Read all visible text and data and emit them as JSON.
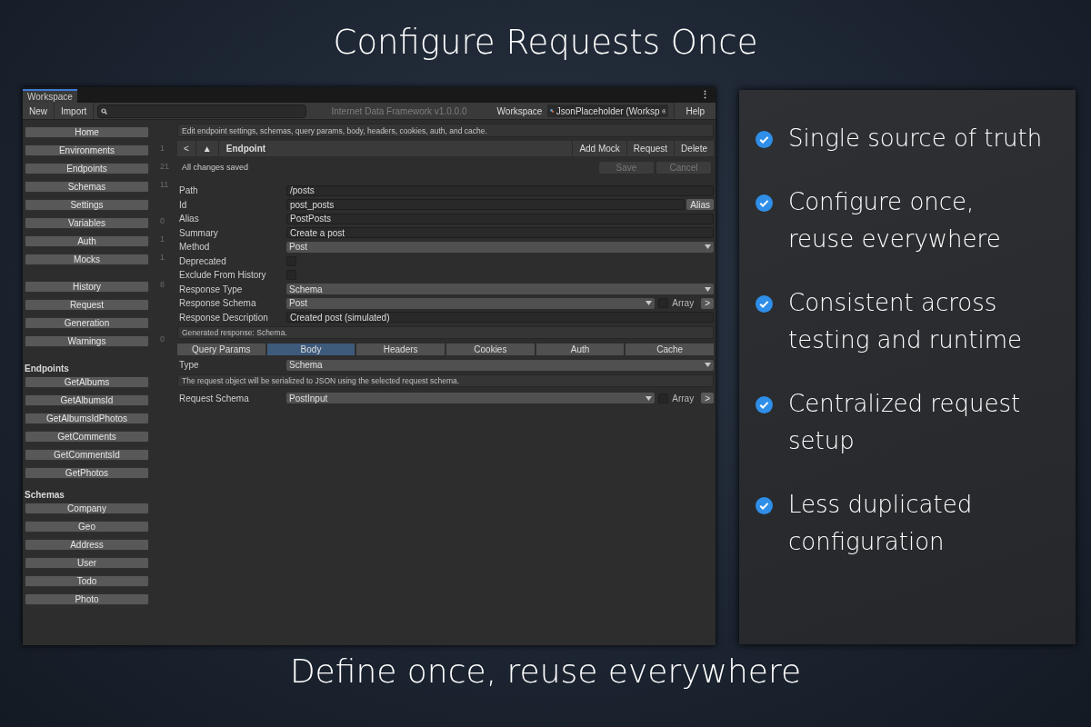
{
  "heading": "Configure Requests Once",
  "window": {
    "tab": {
      "label": "Workspace",
      "selected": true
    },
    "menu_glyph": "⋮",
    "toolbar": {
      "buttons": [
        "New",
        "Import"
      ],
      "title": "Internet Data Framework v1.0.0.0",
      "workspace_label": "Workspace",
      "workspace_value": "JsonPlaceholder (Worksp",
      "help": "Help"
    },
    "sidebar": {
      "nav_groups": [
        [
          {
            "label": "Home"
          },
          {
            "label": "Environments",
            "count": "1"
          },
          {
            "label": "Endpoints",
            "count": "21"
          },
          {
            "label": "Schemas",
            "count": "11"
          },
          {
            "label": "Settings"
          },
          {
            "label": "Variables",
            "count": "0"
          },
          {
            "label": "Auth",
            "count": "1"
          },
          {
            "label": "Mocks",
            "count": "1"
          }
        ],
        [
          {
            "label": "History",
            "count": "8"
          },
          {
            "label": "Request"
          },
          {
            "label": "Generation"
          },
          {
            "label": "Warnings",
            "count": "0"
          }
        ]
      ],
      "sections": [
        {
          "title": "Endpoints",
          "items": [
            "GetAlbums",
            "GetAlbumsId",
            "GetAlbumsIdPhotos",
            "GetComments",
            "GetCommentsId",
            "GetPhotos"
          ]
        },
        {
          "title": "Schemas",
          "items": [
            "Company",
            "Geo",
            "Address",
            "User",
            "Todo",
            "Photo"
          ]
        }
      ]
    },
    "main": {
      "description": "Edit endpoint settings, schemas, query params, body, headers, cookies, auth, and cache.",
      "header": {
        "back": "<",
        "up": "▲",
        "title": "Endpoint",
        "actions": [
          "Add Mock",
          "Request",
          "Delete"
        ]
      },
      "status": "All changes saved",
      "save": {
        "label": "Save",
        "disabled": true
      },
      "cancel": {
        "label": "Cancel",
        "disabled": true
      },
      "fields": [
        {
          "kind": "text",
          "label": "Path",
          "value": "/posts"
        },
        {
          "kind": "text",
          "label": "Id",
          "value": "post_posts",
          "button": "Alias"
        },
        {
          "kind": "text",
          "label": "Alias",
          "value": "PostPosts"
        },
        {
          "kind": "text",
          "label": "Summary",
          "value": "Create a post"
        },
        {
          "kind": "select",
          "label": "Method",
          "value": "Post"
        },
        {
          "kind": "checkbox",
          "label": "Deprecated",
          "checked": false
        },
        {
          "kind": "checkbox",
          "label": "Exclude From History",
          "checked": false
        },
        {
          "kind": "select",
          "label": "Response Type",
          "value": "Schema"
        },
        {
          "kind": "schema",
          "label": "Response Schema",
          "value": "Post",
          "array_label": "Array",
          "array": false,
          "button": ">"
        },
        {
          "kind": "text",
          "label": "Response Description",
          "value": "Created post (simulated)"
        },
        {
          "kind": "note",
          "text": "Generated response: Schema."
        }
      ],
      "tabs": [
        {
          "label": "Query Params",
          "selected": false
        },
        {
          "label": "Body",
          "selected": true
        },
        {
          "label": "Headers",
          "selected": false
        },
        {
          "label": "Cookies",
          "selected": false
        },
        {
          "label": "Auth",
          "selected": false
        },
        {
          "label": "Cache",
          "selected": false
        }
      ],
      "body_fields": [
        {
          "kind": "select",
          "label": "Type",
          "value": "Schema"
        },
        {
          "kind": "note",
          "text": "The request object will be serialized to JSON using the selected request schema."
        },
        {
          "kind": "schema",
          "label": "Request Schema",
          "value": "PostInput",
          "array_label": "Array",
          "array": false,
          "button": ">"
        }
      ]
    }
  },
  "benefits": [
    {
      "text": "Single source of truth"
    },
    {
      "text": "Configure once,\nreuse everywhere"
    },
    {
      "text": "Consistent across\ntesting and runtime"
    },
    {
      "text": "Centralized request\nsetup"
    },
    {
      "text": "Less duplicated\nconfiguration"
    }
  ],
  "footer": "Define once, reuse everywhere"
}
